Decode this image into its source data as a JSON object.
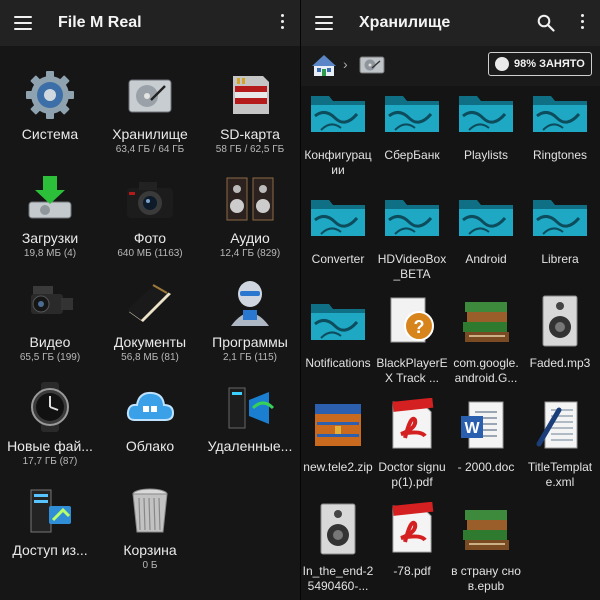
{
  "left_panel": {
    "title": "File M Real",
    "items": [
      {
        "label": "Система",
        "sub": "",
        "icon": "gear-icon"
      },
      {
        "label": "Хранилище",
        "sub": "63,4 ГБ / 64 ГБ",
        "icon": "hard-drive-icon"
      },
      {
        "label": "SD-карта",
        "sub": "58 ГБ / 62,5 ГБ",
        "icon": "sd-card-icon"
      },
      {
        "label": "Загрузки",
        "sub": "19,8 МБ (4)",
        "icon": "download-icon"
      },
      {
        "label": "Фото",
        "sub": "640 МБ (1163)",
        "icon": "camera-icon"
      },
      {
        "label": "Аудио",
        "sub": "12,4 ГБ (829)",
        "icon": "speakers-icon"
      },
      {
        "label": "Видео",
        "sub": "65,5 ГБ (199)",
        "icon": "video-camera-icon"
      },
      {
        "label": "Документы",
        "sub": "56,8 МБ (81)",
        "icon": "notebook-icon"
      },
      {
        "label": "Программы",
        "sub": "2,1 ГБ (115)",
        "icon": "robot-icon"
      },
      {
        "label": "Новые фай...",
        "sub": "17,7 ГБ (87)",
        "icon": "watch-icon"
      },
      {
        "label": "Облако",
        "sub": "",
        "icon": "cloud-icon"
      },
      {
        "label": "Удаленные...",
        "sub": "",
        "icon": "network-icon"
      },
      {
        "label": "Доступ из...",
        "sub": "",
        "icon": "server-access-icon"
      },
      {
        "label": "Корзина",
        "sub": "0 Б",
        "icon": "trash-icon"
      }
    ]
  },
  "right_panel": {
    "title": "Хранилище",
    "storage_badge": "98% ЗАНЯТО",
    "files": [
      {
        "name": "Конфигурации",
        "kind": "folder"
      },
      {
        "name": "СберБанк",
        "kind": "folder"
      },
      {
        "name": "Playlists",
        "kind": "folder"
      },
      {
        "name": "Ringtones",
        "kind": "folder"
      },
      {
        "name": "Converter",
        "kind": "folder"
      },
      {
        "name": "HDVideoBox_BETA",
        "kind": "folder"
      },
      {
        "name": "Android",
        "kind": "folder"
      },
      {
        "name": "Librera",
        "kind": "folder"
      },
      {
        "name": "Notifications",
        "kind": "folder"
      },
      {
        "name": "BlackPlayerEX Track ...",
        "kind": "unknown"
      },
      {
        "name": "com.google.android.G...",
        "kind": "books"
      },
      {
        "name": "Faded.mp3",
        "kind": "audio"
      },
      {
        "name": "new.tele2.zip",
        "kind": "archive"
      },
      {
        "name": "Doctor signup(1).pdf",
        "kind": "pdf"
      },
      {
        "name": "- 2000.doc",
        "kind": "doc"
      },
      {
        "name": "TitleTemplate.xml",
        "kind": "xml"
      },
      {
        "name": "In_the_end-25490460-...",
        "kind": "audio"
      },
      {
        "name": "-78.pdf",
        "kind": "pdf"
      },
      {
        "name": "в страну снов.epub",
        "kind": "books"
      }
    ]
  },
  "colors": {
    "appbar": "#222222",
    "folder": "#1ea8c4",
    "pdf": "#d42020"
  }
}
